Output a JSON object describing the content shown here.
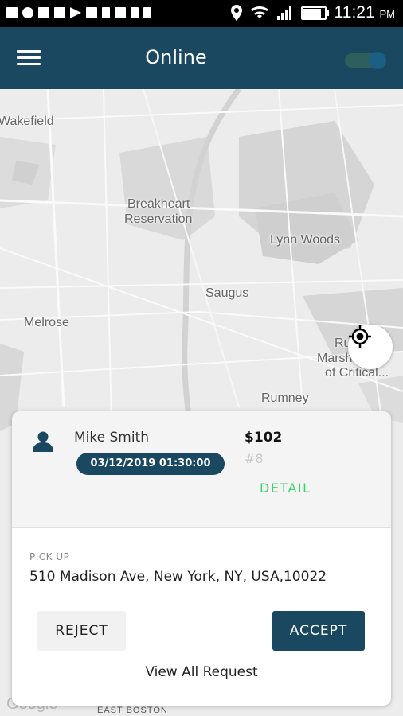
{
  "status_bar": {
    "time": "11:21",
    "ampm": "PM",
    "icons": [
      "notification-icon",
      "whatsapp-icon",
      "notification-icon",
      "gallery-icon",
      "play-store-icon",
      "facebook-icon",
      "person-icon",
      "app-icon",
      "bell-icon",
      "person-icon",
      "location-icon",
      "wifi-icon",
      "signal-icon",
      "battery-icon"
    ]
  },
  "app_bar": {
    "title": "Online",
    "toggle_on": true
  },
  "map": {
    "labels": {
      "wakefield": "Wakefield",
      "breakheart_1": "Breakheart",
      "breakheart_2": "Reservation",
      "lynn_woods": "Lynn Woods",
      "saugus": "Saugus",
      "melrose": "Melrose",
      "marsh_1": "Ru",
      "marsh_2": "Marsh Area",
      "marsh_3": "of Critical...",
      "rumney": "Rumney",
      "east_boston": "EAST BOSTON",
      "google": "Google"
    }
  },
  "request": {
    "rider_name": "Mike Smith",
    "datetime": "03/12/2019 01:30:00",
    "price": "$102",
    "request_number": "#8",
    "detail_label": "DETAIL",
    "pickup_label": "PICK UP",
    "pickup_address": "510 Madison Ave, New York, NY, USA,10022",
    "reject_label": "REJECT",
    "accept_label": "ACCEPT",
    "view_all_label": "View All Request"
  },
  "colors": {
    "primary": "#1a4860",
    "detail_green": "#38d66a"
  }
}
